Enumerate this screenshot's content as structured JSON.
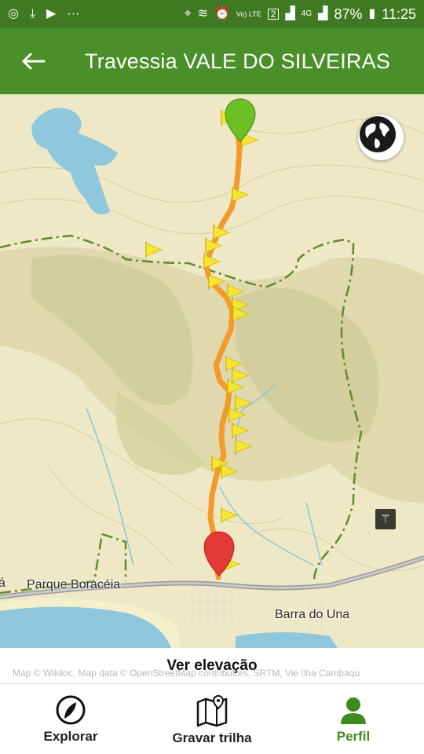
{
  "status_bar": {
    "left_icons": [
      "chrome-icon",
      "download-icon",
      "youtube-icon",
      "more-dots-icon"
    ],
    "indicators": [
      "location-icon",
      "vibrate-icon",
      "alarm-icon",
      "volte-icon",
      "sim-2-icon",
      "signal-icon",
      "4g-icon",
      "signal-icon"
    ],
    "volte_text": "Vo) LTE",
    "sim_text": "2",
    "network_text": "4G",
    "battery_percent": "87%",
    "time": "11:25"
  },
  "app_bar": {
    "back_icon": "back-arrow-icon",
    "title": "Travessia VALE DO SILVEIRAS"
  },
  "map": {
    "labels": {
      "parque": "Parque Boracéia",
      "barra": "Barra do Una",
      "edge_left": "á"
    },
    "globe_icon": "globe-icon",
    "poi_icon": "poi-icon",
    "start_marker_color": "#6cc024",
    "end_marker_color": "#e53935",
    "track_color": "#f39a2a",
    "flag_color": "#f5e633"
  },
  "elevation": {
    "label": "Ver elevação",
    "attribution": "Map © Wikiloc, Map data © OpenStreetMap contributors, SRTM, Vie",
    "attribution_right": "Ilha Cambaqu"
  },
  "bottom_nav": {
    "items": [
      {
        "label": "Explorar",
        "icon": "explore-icon"
      },
      {
        "label": "Gravar trilha",
        "icon": "record-trail-icon"
      },
      {
        "label": "Perfil",
        "icon": "profile-icon"
      }
    ],
    "active_color": "#3f8a1e"
  }
}
